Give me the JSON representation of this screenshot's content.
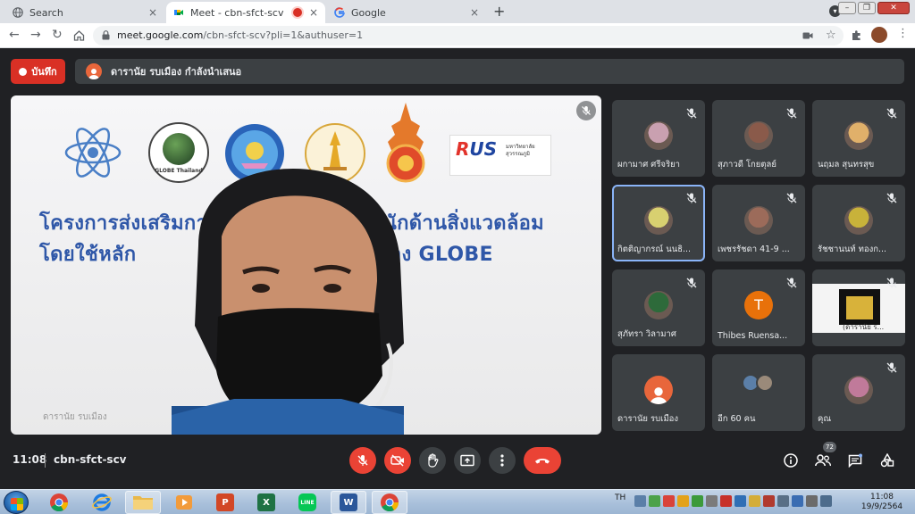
{
  "browser": {
    "tabs": [
      {
        "title": "Search",
        "icon": "globe-icon",
        "active": false
      },
      {
        "title": "Meet - cbn-sfct-scv",
        "icon": "google-meet-icon",
        "active": true,
        "recording": true
      },
      {
        "title": "Google",
        "icon": "google-icon",
        "active": false
      }
    ],
    "close_glyph": "×",
    "new_tab_glyph": "+",
    "url_host": "meet.google.com",
    "url_path": "/cbn-sfct-scv?pli=1&authuser=1"
  },
  "meet": {
    "record_label": "บันทึก",
    "presenter_text": "ดารานัย รบเมือง กำลังนำเสนอ",
    "main_video": {
      "banner_line1": "โครงการส่งเสริมกา",
      "banner_line1b": "หนักด้านสิ่งแวดล้อม",
      "banner_line2": "โดยใช้หลัก",
      "banner_line2b": "อง GLOBE",
      "logo_globe_text": "GLOBE Thailand",
      "rus_text": "RUS",
      "rus_sub": "มหาวิทยาลัย สุวรรณภูมิ",
      "name_tag": "ดารานัย รบเมือง"
    },
    "participants": [
      {
        "name": "ผกามาศ ศรีจริยา",
        "muted": true
      },
      {
        "name": "สุภาวดี โกยตุลย์",
        "muted": true
      },
      {
        "name": "นฤมล สุนทรสุข",
        "muted": true
      },
      {
        "name": "กิตติญากรณ์ นนธิ...",
        "muted": true,
        "speaking": true
      },
      {
        "name": "เพชรรัชดา 41-9 ...",
        "muted": true
      },
      {
        "name": "รัชชานนท์ ทองก...",
        "muted": true
      },
      {
        "name": "สุภัทรา วิลามาศ",
        "muted": true
      },
      {
        "name": "Thibes Ruensa...",
        "muted": true,
        "letter": "T"
      },
      {
        "name": "",
        "muted": true,
        "presenting": true,
        "mini_text": "(ดารานัย ร..."
      },
      {
        "name": "ดารานัย รบเมือง",
        "muted": false
      },
      {
        "name": "อีก 60 คน",
        "muted": false,
        "more": true
      },
      {
        "name": "คุณ",
        "muted": true
      }
    ],
    "clock": "11:08",
    "meeting_code": "cbn-sfct-scv",
    "participant_count": "72",
    "colors": {
      "accent_red": "#ea4335",
      "surface": "#3c4043",
      "background": "#202124",
      "speaking_border": "#8ab4f8"
    }
  },
  "taskbar": {
    "apps": [
      {
        "name": "chrome",
        "open": false
      },
      {
        "name": "internet-explorer",
        "open": false
      },
      {
        "name": "file-explorer",
        "open": true
      },
      {
        "name": "media-player",
        "open": false
      },
      {
        "name": "powerpoint",
        "label": "P",
        "open": false
      },
      {
        "name": "excel",
        "label": "X",
        "open": false
      },
      {
        "name": "line",
        "label": "LINE",
        "open": false
      },
      {
        "name": "word",
        "label": "W",
        "open": true
      },
      {
        "name": "chrome-active",
        "open": true
      }
    ],
    "lang": "TH",
    "time": "11:08",
    "date": "19/9/2564"
  }
}
